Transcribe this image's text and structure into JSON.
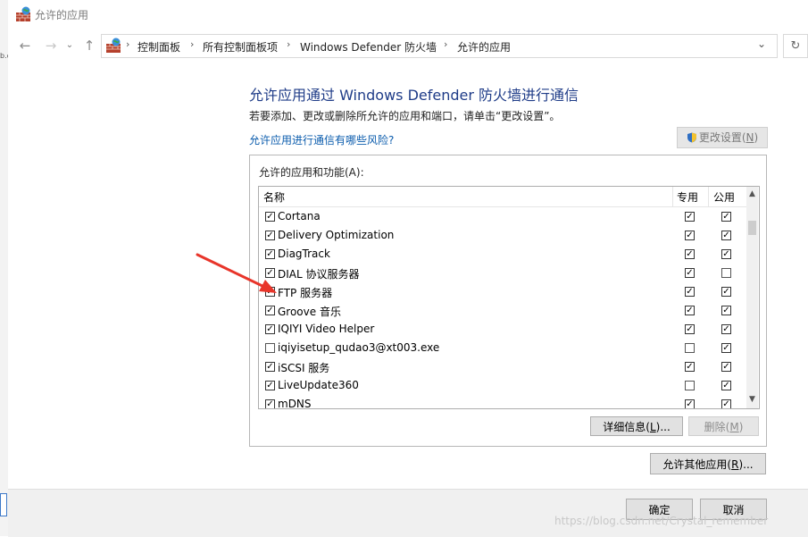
{
  "window": {
    "title": "允许的应用"
  },
  "background": {
    "fragment": "b.c"
  },
  "nav": {
    "back_icon": "back-arrow-icon",
    "forward_icon": "forward-arrow-icon",
    "up_icon": "up-arrow-icon",
    "breadcrumb": [
      "控制面板",
      "所有控制面板项",
      "Windows Defender 防火墙",
      "允许的应用"
    ],
    "refresh_icon": "refresh-icon"
  },
  "content": {
    "heading": "允许应用通过 Windows Defender 防火墙进行通信",
    "subtext": "若要添加、更改或删除所允许的应用和端口，请单击“更改设置”。",
    "risk_link": "允许应用进行通信有哪些风险?",
    "change_settings": {
      "label": "更改设置",
      "hotkey": "N"
    }
  },
  "list": {
    "group_label": "允许的应用和功能(A):",
    "columns": {
      "name": "名称",
      "private": "专用",
      "public": "公用"
    },
    "rows": [
      {
        "name": "Cortana",
        "enabled": true,
        "private": true,
        "public": true
      },
      {
        "name": "Delivery Optimization",
        "enabled": true,
        "private": true,
        "public": true
      },
      {
        "name": "DiagTrack",
        "enabled": true,
        "private": true,
        "public": true
      },
      {
        "name": "DIAL 协议服务器",
        "enabled": true,
        "private": true,
        "public": false
      },
      {
        "name": "FTP 服务器",
        "enabled": true,
        "private": true,
        "public": true
      },
      {
        "name": "Groove 音乐",
        "enabled": true,
        "private": true,
        "public": true
      },
      {
        "name": "IQIYI Video Helper",
        "enabled": true,
        "private": true,
        "public": true
      },
      {
        "name": "iqiyisetup_qudao3@xt003.exe",
        "enabled": false,
        "private": false,
        "public": true
      },
      {
        "name": "iSCSI 服务",
        "enabled": true,
        "private": true,
        "public": true
      },
      {
        "name": "LiveUpdate360",
        "enabled": true,
        "private": false,
        "public": true
      },
      {
        "name": "mDNS",
        "enabled": true,
        "private": true,
        "public": true
      }
    ],
    "details_button": {
      "label": "详细信息",
      "hotkey": "L",
      "suffix": "..."
    },
    "delete_button": {
      "label": "删除",
      "hotkey": "M"
    }
  },
  "allow_other_button": {
    "label": "允许其他应用",
    "hotkey": "R",
    "suffix": "..."
  },
  "footer": {
    "ok": "确定",
    "cancel": "取消"
  },
  "watermark": "https://blog.csdn.net/Crystal_remember",
  "colors": {
    "heading": "#1f3c88",
    "link": "#0b5cad",
    "arrow": "#e8352a"
  }
}
